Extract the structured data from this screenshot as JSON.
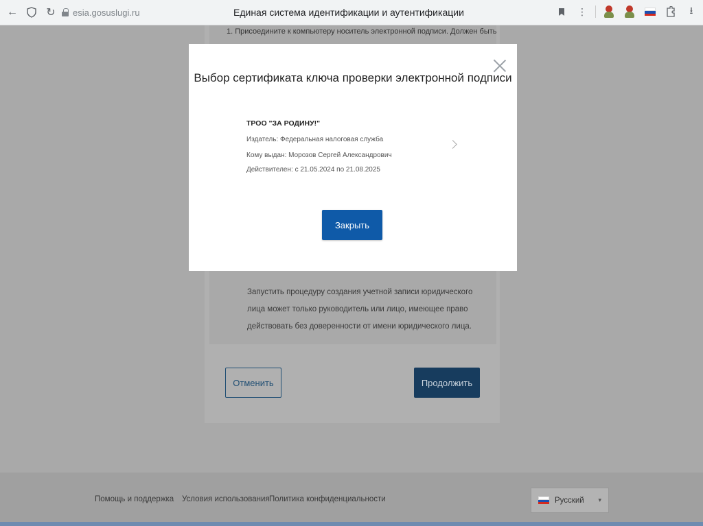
{
  "browser": {
    "domain": "esia.gosuslugi.ru",
    "title": "Единая система идентификации и аутентификации"
  },
  "background": {
    "step_text": "1. Присоедините к компьютеру носитель электронной подписи. Должен быть",
    "info_text": "Запустить процедуру создания учетной записи юридического лица может только руководитель или лицо, имеющее право действовать без доверенности от имени юридического лица.",
    "cancel_label": "Отменить",
    "continue_label": "Продолжить"
  },
  "footer": {
    "links": [
      "Помощь и поддержка",
      "Условия использования",
      "Политика конфиденциальности"
    ],
    "language": "Русский"
  },
  "modal": {
    "title": "Выбор сертификата ключа проверки электронной подписи",
    "certificate": {
      "name": "ТРОО \"ЗА РОДИНУ!\"",
      "issuer": "Издатель: Федеральная налоговая служба",
      "issued_to": "Кому выдан: Морозов Сергей Александрович",
      "validity": "Действителен:  с 21.05.2024  по 21.08.2025"
    },
    "close_label": "Закрыть"
  },
  "colors": {
    "primary_button": "#0f5aa8",
    "overlay": "#a9a9a9"
  }
}
